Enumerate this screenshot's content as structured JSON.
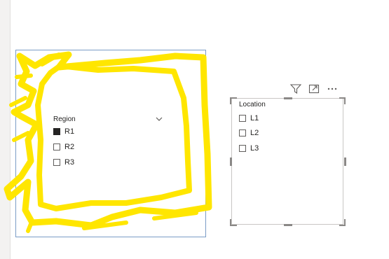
{
  "region_slicer": {
    "title": "Region",
    "items": [
      {
        "label": "R1",
        "checked": true
      },
      {
        "label": "R2",
        "checked": false
      },
      {
        "label": "R3",
        "checked": false
      }
    ]
  },
  "location_slicer": {
    "title": "Location",
    "items": [
      {
        "label": "L1",
        "checked": false
      },
      {
        "label": "L2",
        "checked": false
      },
      {
        "label": "L3",
        "checked": false
      }
    ]
  },
  "header_icons": [
    "filter-icon",
    "focus-mode-icon",
    "more-options-icon"
  ],
  "colors": {
    "highlighter": "#ffe600",
    "selection_border": "#7a9cc6",
    "text": "#252423"
  }
}
